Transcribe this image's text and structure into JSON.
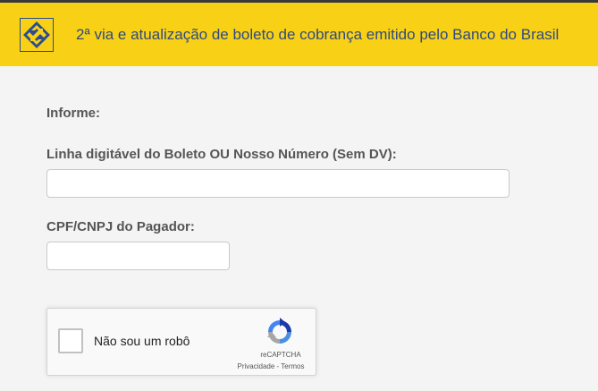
{
  "header": {
    "title": "2ª via e atualização de boleto de cobrança emitido pelo Banco do Brasil",
    "logo_icon": "banco-do-brasil-logo",
    "background": "#f8d117",
    "title_color": "#2e4a82"
  },
  "form": {
    "intro_label": "Informe:",
    "barcode_label": "Linha digitável do Boleto OU Nosso Número (Sem DV):",
    "barcode_value": "",
    "document_label": "CPF/CNPJ do Pagador:",
    "document_value": ""
  },
  "captcha": {
    "label": "Não sou um robô",
    "brand": "reCAPTCHA",
    "privacy_link": "Privacidade",
    "separator": "-",
    "terms_link": "Termos",
    "checked": false
  }
}
